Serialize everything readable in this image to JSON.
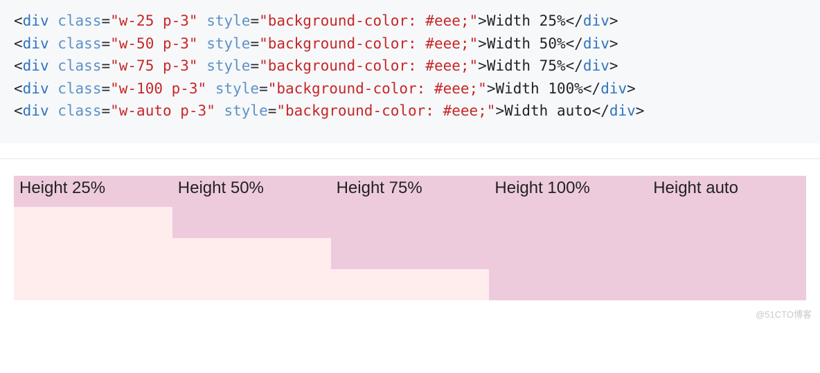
{
  "code_lines": [
    {
      "class_val": "w-25 p-3",
      "style_val": "background-color: #eee;",
      "text": "Width 25%"
    },
    {
      "class_val": "w-50 p-3",
      "style_val": "background-color: #eee;",
      "text": "Width 50%"
    },
    {
      "class_val": "w-75 p-3",
      "style_val": "background-color: #eee;",
      "text": "Width 75%"
    },
    {
      "class_val": "w-100 p-3",
      "style_val": "background-color: #eee;",
      "text": "Width 100%"
    },
    {
      "class_val": "w-auto p-3",
      "style_val": "background-color: #eee;",
      "text": "Width auto"
    }
  ],
  "heights": [
    {
      "label": "Height 25%",
      "cls": "h25"
    },
    {
      "label": "Height 50%",
      "cls": "h50"
    },
    {
      "label": "Height 75%",
      "cls": "h75"
    },
    {
      "label": "Height 100%",
      "cls": "h100"
    },
    {
      "label": "Height auto",
      "cls": "hauto"
    }
  ],
  "watermark": "@51CTO博客"
}
